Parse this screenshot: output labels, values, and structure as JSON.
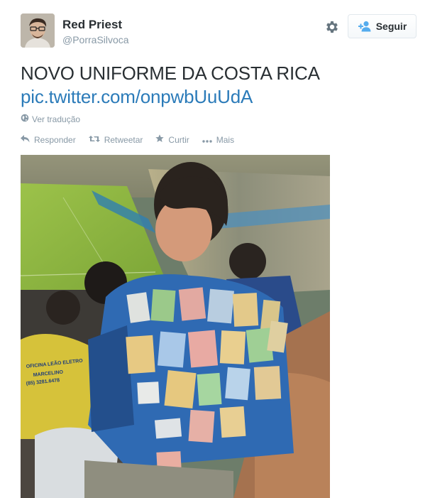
{
  "user": {
    "display_name": "Red Priest",
    "handle": "@PorraSilvoca"
  },
  "header": {
    "follow_label": "Seguir",
    "settings_icon": "gear-icon",
    "follow_icon": "add-user-icon"
  },
  "tweet": {
    "text": "NOVO UNIFORME DA COSTA RICA",
    "link": "pic.twitter.com/onpwbUuUdA",
    "translate_label": "Ver tradução"
  },
  "actions": {
    "reply_label": "Responder",
    "retweet_label": "Retweetar",
    "like_label": "Curtir",
    "more_label": "Mais"
  },
  "photo": {
    "shirt_text_1": "OFICINA LEÃO ELETRO",
    "shirt_text_2": "MARCELINO",
    "shirt_text_3": "(85) 3281.6478"
  },
  "colors": {
    "link": "#2b7bb9",
    "muted": "#8899a6",
    "text": "#292f33",
    "follow_icon": "#55acee"
  }
}
